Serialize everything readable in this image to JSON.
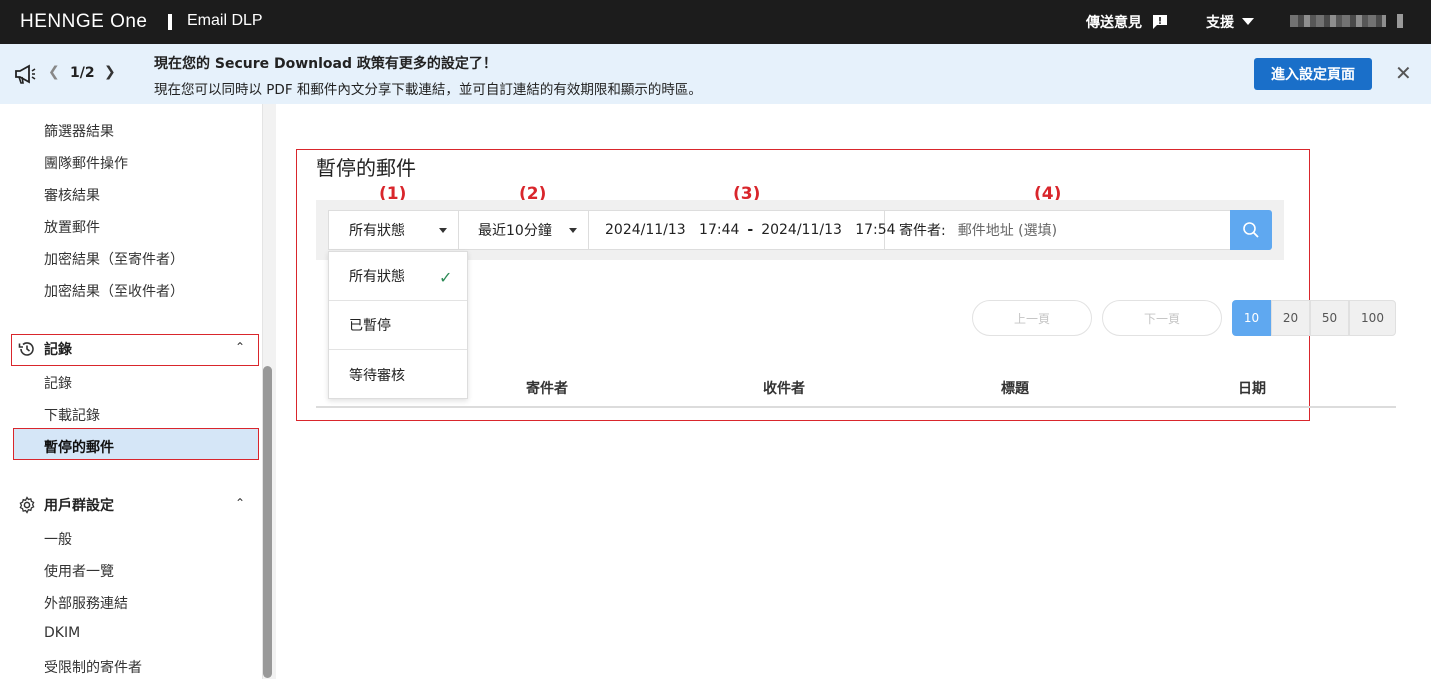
{
  "topbar": {
    "brand": "HENNGE One",
    "product": "Email DLP",
    "feedback_label": "傳送意見",
    "support_label": "支援"
  },
  "banner": {
    "pager": "1/2",
    "title": "現在您的 Secure Download 政策有更多的設定了！",
    "text": "現在您可以同時以 PDF 和郵件內文分享下載連結，並可自訂連結的有效期限和顯示的時區。",
    "button_label": "進入設定頁面"
  },
  "sidebar": {
    "items_top": [
      "篩選器結果",
      "團隊郵件操作",
      "審核結果",
      "放置郵件",
      "加密結果（至寄件者）",
      "加密結果（至收件者）"
    ],
    "section_records": "記錄",
    "records_items": [
      "記錄",
      "下載記錄",
      "暫停的郵件"
    ],
    "section_user_groups": "用戶群設定",
    "user_group_items": [
      "一般",
      "使用者一覽",
      "外部服務連結",
      "DKIM",
      "受限制的寄件者"
    ]
  },
  "main": {
    "title": "暫停的郵件",
    "annotations": [
      "(1)",
      "(2)",
      "(3)",
      "(4)"
    ],
    "filter": {
      "status": "所有狀態",
      "period": "最近10分鐘",
      "date_from": "2024/11/13   17:44",
      "date_sep": "-",
      "date_to": "2024/11/13   17:54",
      "sender_label": "寄件者:",
      "sender_placeholder": "郵件地址 (選填)"
    },
    "status_options": [
      "所有狀態",
      "已暫停",
      "等待審核"
    ],
    "prev_page": "上一頁",
    "next_page": "下一頁",
    "page_sizes": [
      "10",
      "20",
      "50",
      "100"
    ],
    "columns": [
      "寄件者",
      "收件者",
      "標題",
      "日期"
    ]
  },
  "colors": {
    "accent": "#1a6fc9",
    "search_button": "#5fa8f0",
    "highlight_border": "#d9262c",
    "banner_bg": "#e6f1fb"
  }
}
